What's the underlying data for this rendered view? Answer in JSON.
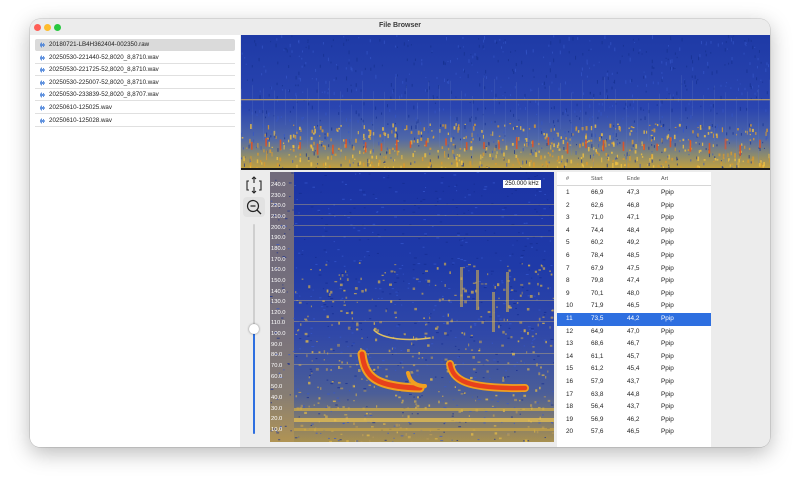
{
  "window": {
    "title": "File Browser"
  },
  "files": [
    "20180721-LB4H362404-002350.raw",
    "20250530-221440-52,8020_8,8710.wav",
    "20250530-221725-52,8020_8,8710.wav",
    "20250530-225007-52,8020_8,8710.wav",
    "20250530-233839-52,8020_8,8707.wav",
    "20250610-125025.wav",
    "20250610-125028.wav"
  ],
  "selected_file_index": 0,
  "spectrogram": {
    "frequency_badge": "250.000 kHz",
    "y_ticks": [
      "240.0",
      "230.0",
      "220.0",
      "210.0",
      "200.0",
      "190.0",
      "180.0",
      "170.0",
      "160.0",
      "150.0",
      "140.0",
      "130.0",
      "120.0",
      "110.0",
      "100.0",
      "90.0",
      "80.0",
      "70.0",
      "60.0",
      "50.0",
      "40.0",
      "30.0",
      "20.0",
      "10.0"
    ]
  },
  "zoom_slider": {
    "value": 0.5
  },
  "icons": {
    "fit": "fit-vertical-icon",
    "zoom_out": "zoom-out-icon",
    "file": "waveform-icon"
  },
  "colors": {
    "selection": "#2e6fe0",
    "spectrogram_bg": "#1d35a8",
    "call": "#e8401c"
  },
  "table": {
    "headers": [
      "#",
      "Start",
      "Ende",
      "Art"
    ],
    "selected_index": 10,
    "rows": [
      [
        "1",
        "66,9",
        "47,3",
        "Ppip"
      ],
      [
        "2",
        "62,6",
        "46,8",
        "Ppip"
      ],
      [
        "3",
        "71,0",
        "47,1",
        "Ppip"
      ],
      [
        "4",
        "74,4",
        "48,4",
        "Ppip"
      ],
      [
        "5",
        "60,2",
        "49,2",
        "Ppip"
      ],
      [
        "6",
        "78,4",
        "48,5",
        "Ppip"
      ],
      [
        "7",
        "67,9",
        "47,5",
        "Ppip"
      ],
      [
        "8",
        "79,8",
        "47,4",
        "Ppip"
      ],
      [
        "9",
        "70,1",
        "48,0",
        "Ppip"
      ],
      [
        "10",
        "71,9",
        "46,5",
        "Ppip"
      ],
      [
        "11",
        "73,5",
        "44,2",
        "Ppip"
      ],
      [
        "12",
        "64,9",
        "47,0",
        "Ppip"
      ],
      [
        "13",
        "68,6",
        "46,7",
        "Ppip"
      ],
      [
        "14",
        "61,1",
        "45,7",
        "Ppip"
      ],
      [
        "15",
        "61,2",
        "45,4",
        "Ppip"
      ],
      [
        "16",
        "57,9",
        "43,7",
        "Ppip"
      ],
      [
        "17",
        "63,8",
        "44,8",
        "Ppip"
      ],
      [
        "18",
        "56,4",
        "43,7",
        "Ppip"
      ],
      [
        "19",
        "56,9",
        "46,2",
        "Ppip"
      ],
      [
        "20",
        "57,6",
        "46,5",
        "Ppip"
      ]
    ]
  }
}
